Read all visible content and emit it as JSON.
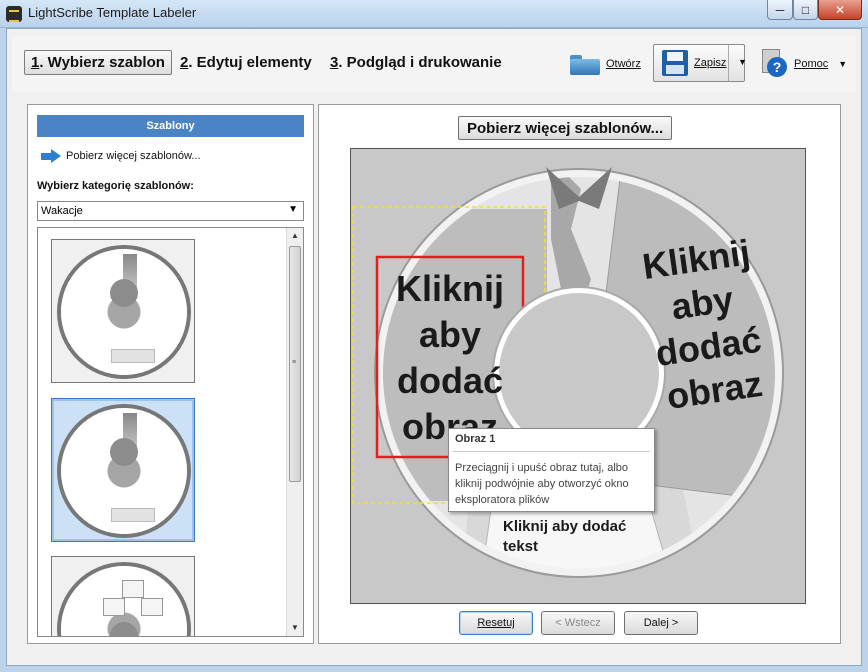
{
  "window": {
    "title": "LightScribe Template Labeler",
    "minimize": "─",
    "maximize": "□",
    "close": "✕"
  },
  "toolbar": {
    "step1_num": "1",
    "step1_label": ". Wybierz szablon",
    "step2_num": "2",
    "step2_label": ". Edytuj elementy",
    "step3_num": "3",
    "step3_label": ". Podgląd i drukowanie",
    "open_label": "Otwórz",
    "save_label": "Zapisz",
    "help_label": "Pomoc",
    "dropdown_glyph": "▼"
  },
  "left_panel": {
    "header": "Szablony",
    "more_link": "Pobierz więcej szablonów...",
    "category_label": "Wybierz kategorię szablonów:",
    "category_value": "Wakacje",
    "scroll_up": "▲",
    "scroll_down": "▼",
    "scroll_grip": "≡"
  },
  "right_panel": {
    "more_button": "Pobierz więcej szablonów...",
    "image_placeholder_left": [
      "Kliknij",
      "aby",
      "dodać",
      "obraz"
    ],
    "image_placeholder_right": [
      "Kliknij",
      "aby",
      "dodać",
      "obraz"
    ],
    "text_placeholder": [
      "Kliknij aby dodać",
      "tekst"
    ],
    "reset_button": "Resetuj",
    "back_button": "< Wstecz",
    "next_button": "Dalej >"
  },
  "tooltip": {
    "title": "Obraz 1",
    "body": "Przeciągnij i upuść obraz tutaj, albo kliknij podwójnie aby otworzyć okno eksploratora plików"
  },
  "colors": {
    "accent": "#4b84c4",
    "selection_border": "#e02020",
    "dashed_border": "#f2e12a"
  }
}
